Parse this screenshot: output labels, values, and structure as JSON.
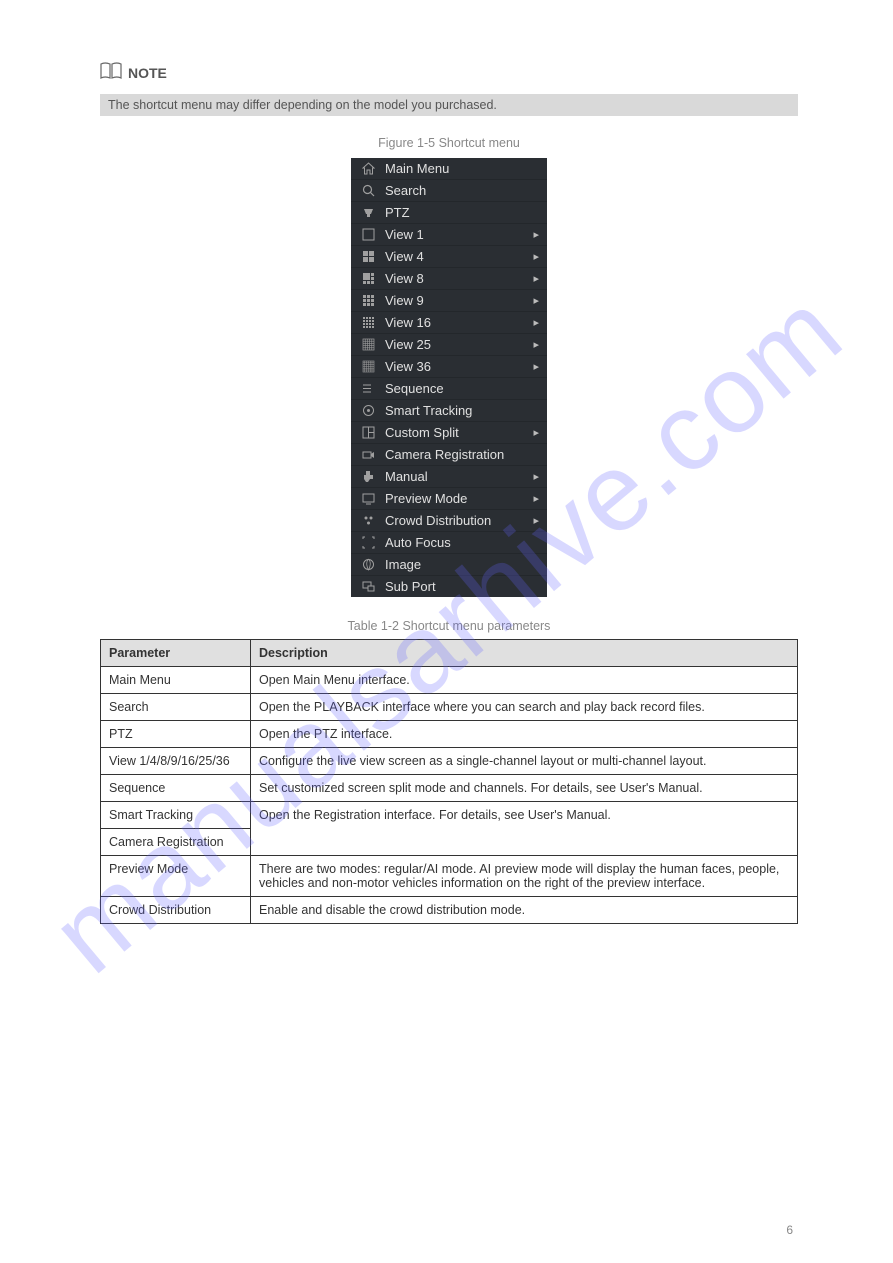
{
  "note": {
    "label": "NOTE",
    "text": "The shortcut menu may differ depending on the model you purchased."
  },
  "figure_label": "Figure 1-5 Shortcut menu",
  "menu": {
    "items": [
      {
        "icon": "home-icon",
        "label": "Main Menu",
        "arrow": false
      },
      {
        "icon": "search-icon",
        "label": "Search",
        "arrow": false
      },
      {
        "icon": "ptz-icon",
        "label": "PTZ",
        "arrow": false
      },
      {
        "icon": "view1-icon",
        "label": "View 1",
        "arrow": true
      },
      {
        "icon": "view4-icon",
        "label": "View 4",
        "arrow": true
      },
      {
        "icon": "view8-icon",
        "label": "View 8",
        "arrow": true
      },
      {
        "icon": "view9-icon",
        "label": "View 9",
        "arrow": true
      },
      {
        "icon": "view16-icon",
        "label": "View 16",
        "arrow": true
      },
      {
        "icon": "view25-icon",
        "label": "View 25",
        "arrow": true
      },
      {
        "icon": "view36-icon",
        "label": "View 36",
        "arrow": true
      },
      {
        "icon": "sequence-icon",
        "label": "Sequence",
        "arrow": false
      },
      {
        "icon": "smart-tracking-icon",
        "label": "Smart Tracking",
        "arrow": false
      },
      {
        "icon": "custom-split-icon",
        "label": "Custom Split",
        "arrow": true
      },
      {
        "icon": "camera-reg-icon",
        "label": "Camera Registration",
        "arrow": false
      },
      {
        "icon": "manual-icon",
        "label": "Manual",
        "arrow": true
      },
      {
        "icon": "preview-mode-icon",
        "label": "Preview Mode",
        "arrow": true
      },
      {
        "icon": "crowd-dist-icon",
        "label": "Crowd Distribution",
        "arrow": true
      },
      {
        "icon": "auto-focus-icon",
        "label": "Auto Focus",
        "arrow": false
      },
      {
        "icon": "image-icon",
        "label": "Image",
        "arrow": false
      },
      {
        "icon": "subport-icon",
        "label": "Sub Port",
        "arrow": false
      }
    ]
  },
  "table_label": "Table 1-2 Shortcut menu parameters",
  "table": {
    "header_param": "Parameter",
    "header_desc": "Description",
    "rows": [
      {
        "param": "Main Menu",
        "desc": "Open Main Menu interface."
      },
      {
        "param": "Search",
        "desc": "Open the PLAYBACK interface where you can search and play back record files."
      },
      {
        "param": "PTZ",
        "desc": "Open the PTZ interface."
      },
      {
        "param": "View 1/4/8/9/16/25/36",
        "desc": "Configure the live view screen as a single-channel layout or multi-channel layout."
      },
      {
        "param": "Sequence",
        "desc": "Set customized screen split mode and channels. For details, see User's Manual."
      },
      {
        "param": "Smart Tracking",
        "desc": "Open the Registration interface. For details, see User's Manual.",
        "rowspan": 2
      },
      {
        "param": "Camera Registration",
        "desc": null
      },
      {
        "param": "Preview Mode",
        "desc": "There are two modes: regular/AI mode. AI preview mode will display the human faces, people, vehicles and non-motor vehicles information on the right of the preview interface."
      },
      {
        "param": "Crowd Distribution",
        "desc": "Enable and disable the crowd distribution mode."
      }
    ]
  },
  "page_number": "6"
}
